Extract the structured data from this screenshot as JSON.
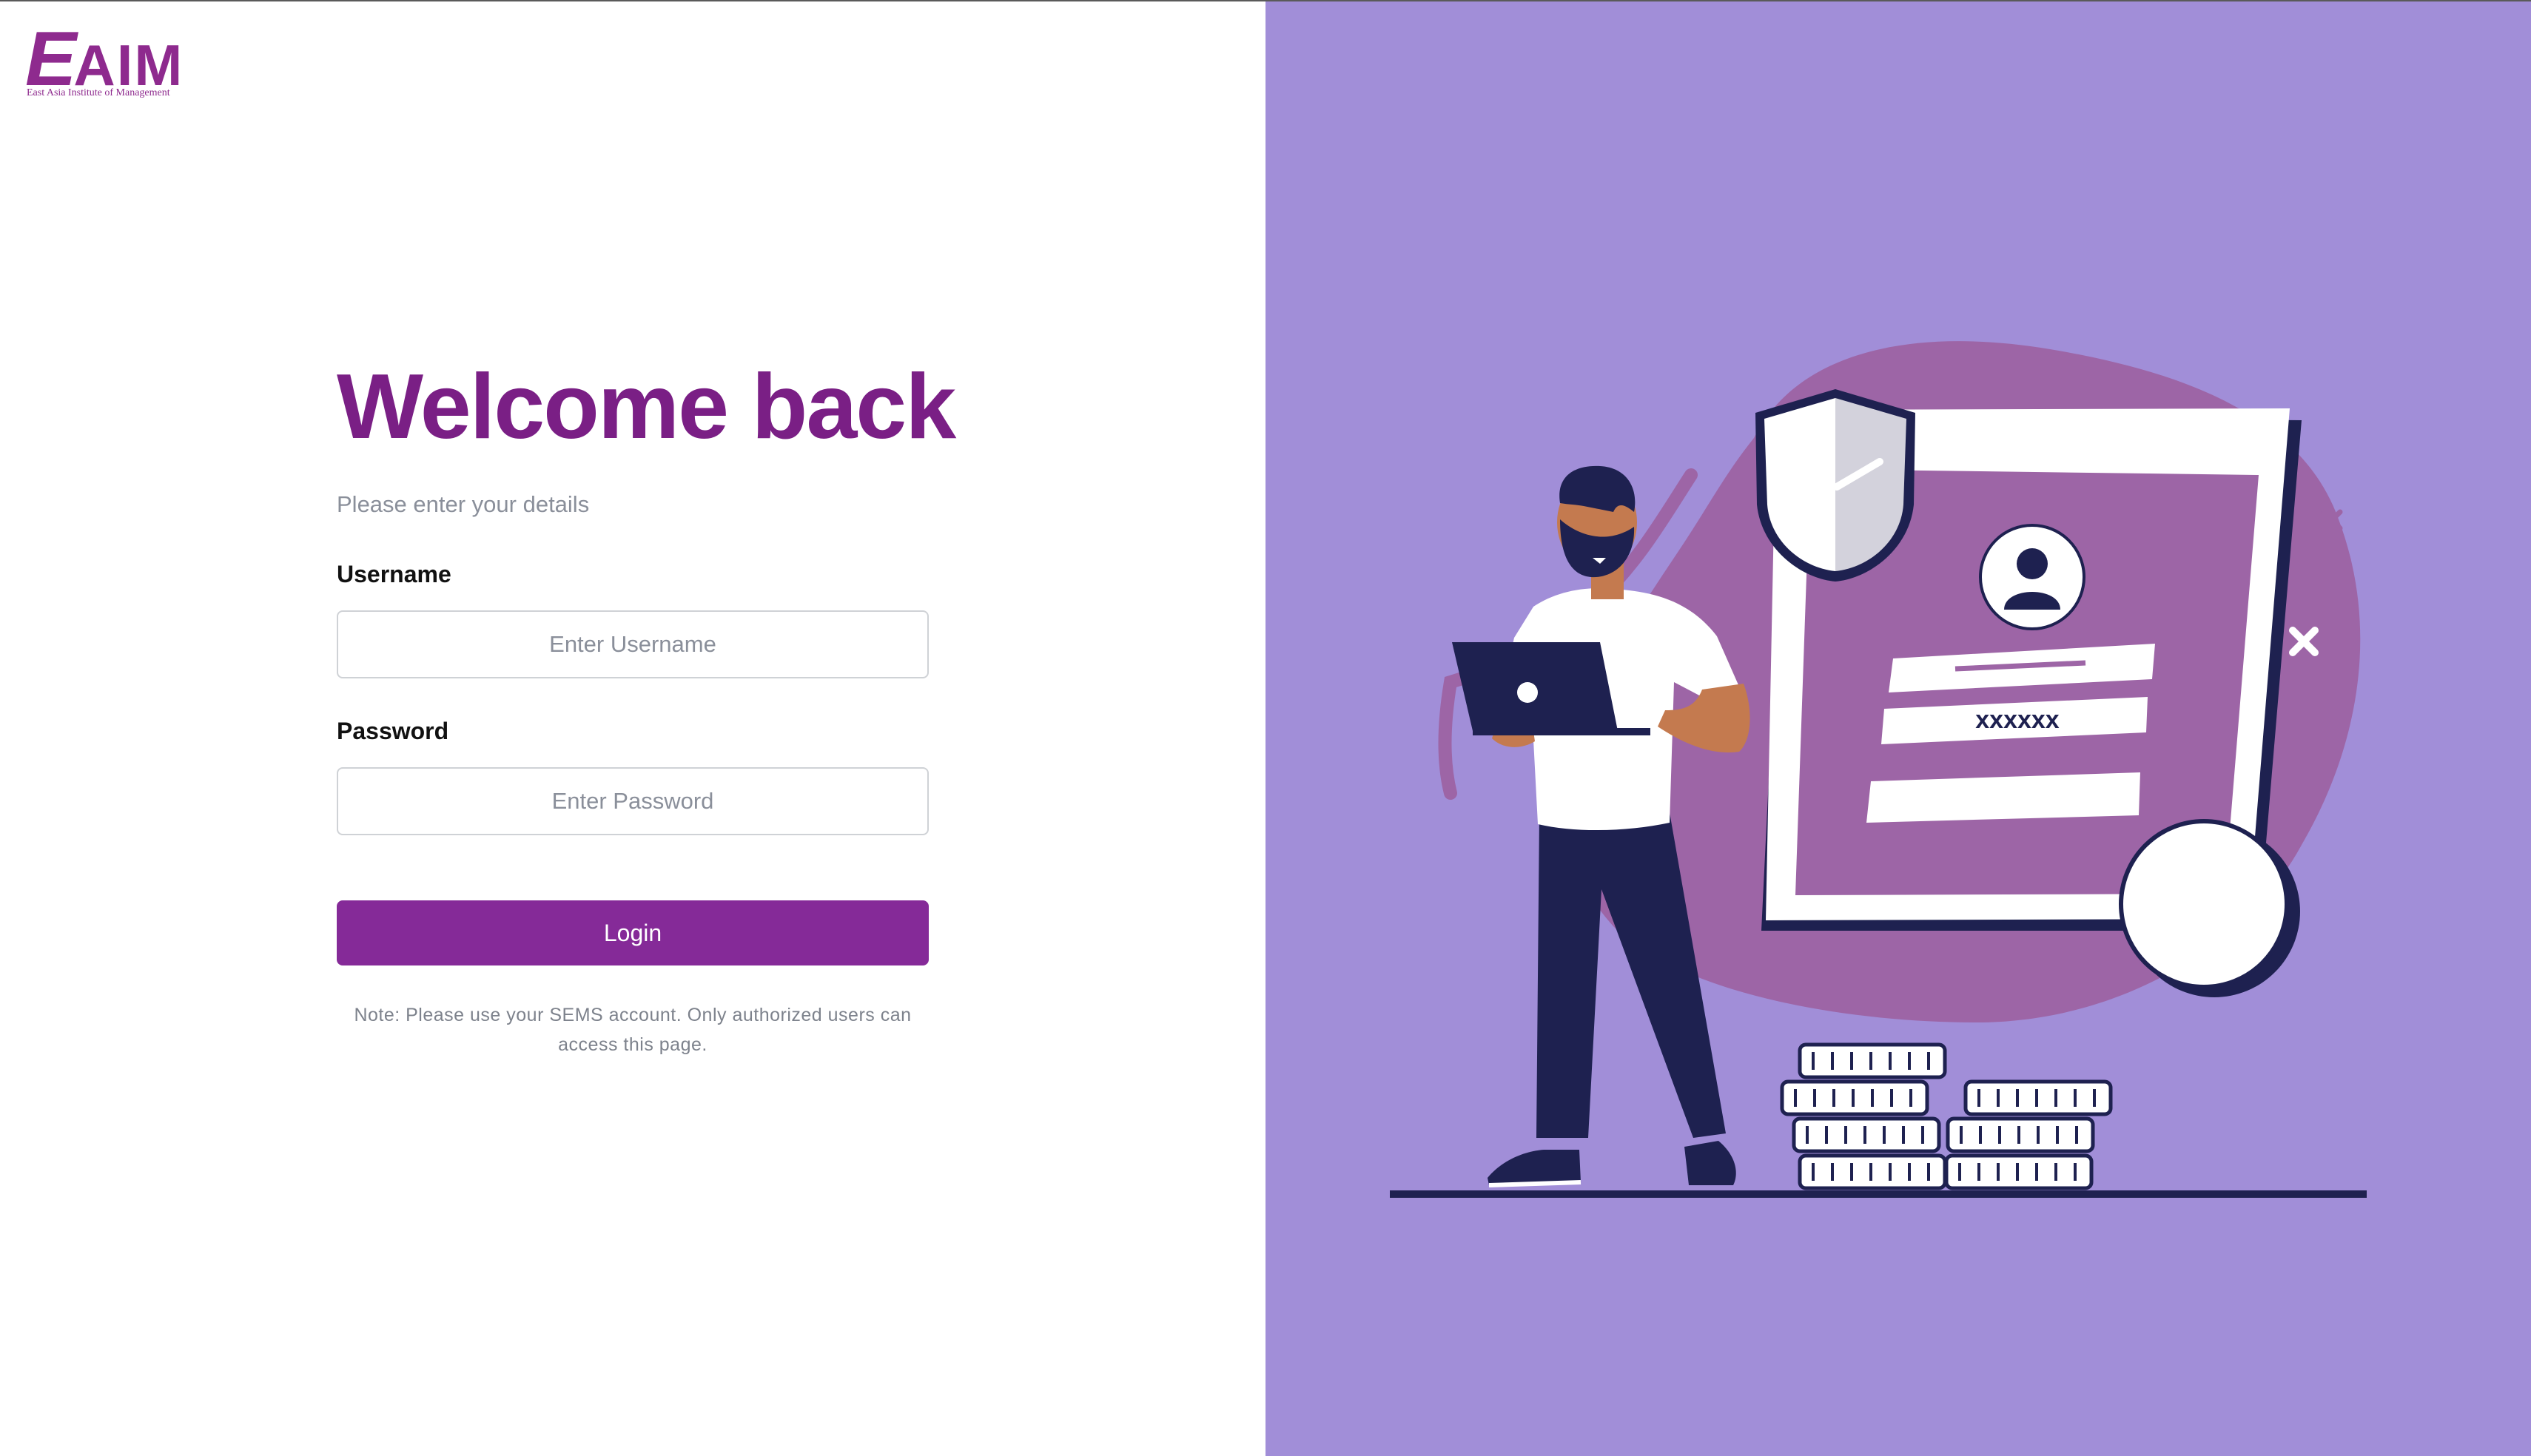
{
  "brand": {
    "logo_mark": "EAIM",
    "logo_subtitle": "East Asia Institute of Management"
  },
  "login": {
    "title": "Welcome back",
    "subtitle": "Please enter your details",
    "username_label": "Username",
    "username_placeholder": "Enter Username",
    "username_value": "",
    "password_label": "Password",
    "password_placeholder": "Enter Password",
    "password_value": "",
    "login_button": "Login",
    "note": "Note: Please use your SEMS account. Only authorized users can access this page."
  },
  "illustration": {
    "password_field_text": "xxxxxx"
  },
  "colors": {
    "brand_purple": "#852a98",
    "title_purple": "#7a1f85",
    "panel_background": "#a18ed8",
    "blob": "#9d65a6",
    "navy": "#1e2150"
  }
}
